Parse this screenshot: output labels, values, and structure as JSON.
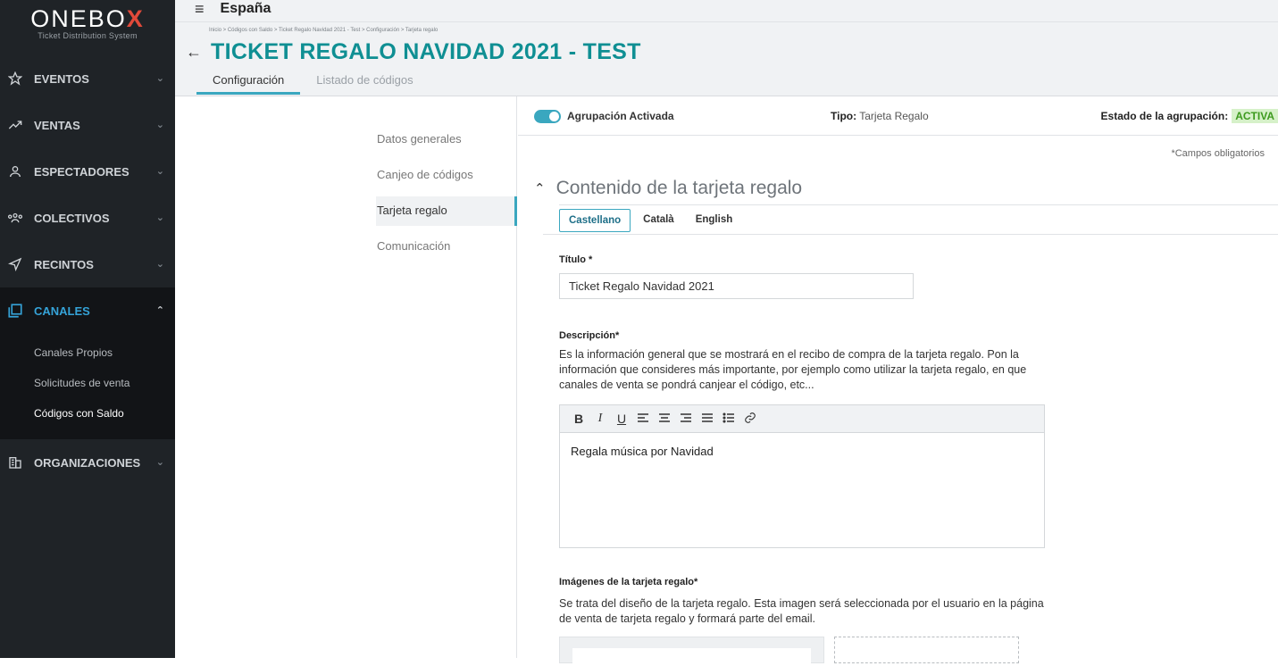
{
  "brand": {
    "name_main": "ONEBO",
    "name_x": "X",
    "subtitle": "Ticket Distribution System"
  },
  "sidebar": {
    "items": [
      {
        "label": "EVENTOS",
        "icon": "star-icon"
      },
      {
        "label": "VENTAS",
        "icon": "trend-icon"
      },
      {
        "label": "ESPECTADORES",
        "icon": "user-icon"
      },
      {
        "label": "COLECTIVOS",
        "icon": "group-icon"
      },
      {
        "label": "RECINTOS",
        "icon": "location-icon"
      },
      {
        "label": "CANALES",
        "icon": "copy-icon"
      },
      {
        "label": "ORGANIZACIONES",
        "icon": "building-icon"
      }
    ],
    "sub_items": [
      "Canales Propios",
      "Solicitudes de venta",
      "Códigos con Saldo"
    ]
  },
  "header": {
    "country": "España",
    "breadcrumb": "Inicio > Códigos con Saldo > Ticket Regalo Navidad 2021 - Test > Configuración > Tarjeta regalo",
    "title": "TICKET REGALO NAVIDAD 2021 - TEST",
    "tabs": [
      "Configuración",
      "Listado de códigos"
    ]
  },
  "submenu": [
    "Datos generales",
    "Canjeo de códigos",
    "Tarjeta regalo",
    "Comunicación"
  ],
  "status": {
    "toggle_label": "Agrupación Activada",
    "tipo_label": "Tipo:",
    "tipo_value": "Tarjeta Regalo",
    "estado_label": "Estado de la agrupación:",
    "estado_value": "ACTIVA"
  },
  "required_note": "*Campos obligatorios",
  "section_title": "Contenido de la tarjeta regalo",
  "languages": [
    "Castellano",
    "Català",
    "English"
  ],
  "form": {
    "titulo_label": "Título *",
    "titulo_value": "Ticket Regalo Navidad 2021",
    "descripcion_label": "Descripción*",
    "descripcion_help": "Es la información general que se mostrará en el recibo de compra de la tarjeta regalo. Pon la información que consideres más importante, por ejemplo como utilizar la tarjeta regalo, en que canales de venta se pondrá canjear el código, etc...",
    "editor_content": "Regala música por Navidad",
    "imagenes_label": "Imágenes de la tarjeta regalo*",
    "imagenes_help": "Se trata del diseño de la tarjeta regalo. Esta imagen será seleccionada por el usuario en la página de venta de tarjeta regalo y formará parte del email."
  },
  "colors": {
    "accent": "#3aa7bf",
    "title": "#0f8f93",
    "sidebar": "#1f2327",
    "active_badge_bg": "#d6f1c9",
    "active_badge_fg": "#3d9a1e"
  }
}
